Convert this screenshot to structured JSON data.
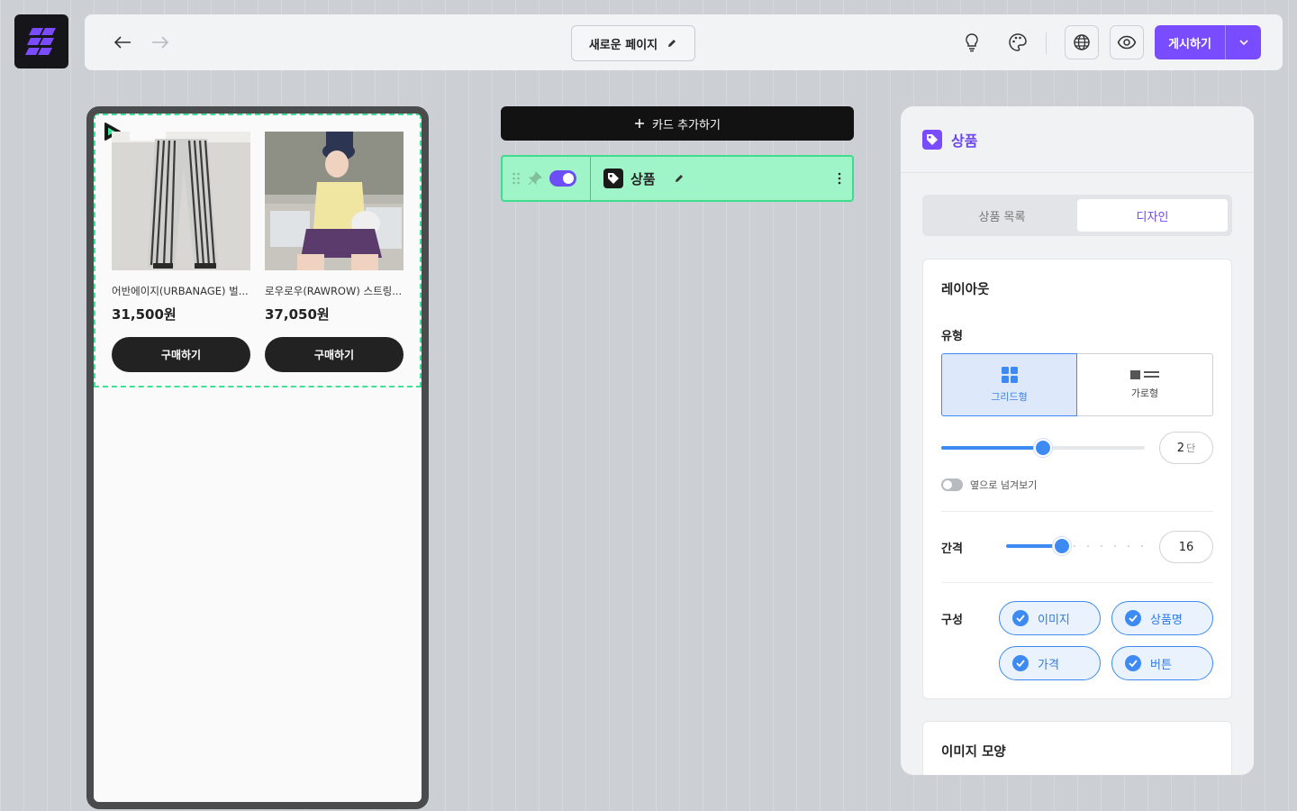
{
  "toolbar": {
    "page_name": "새로운 페이지",
    "publish_label": "게시하기"
  },
  "preview": {
    "products": [
      {
        "name": "어반에이지(URBANAGE) 벌...",
        "price": "31,500원",
        "buy_label": "구매하기"
      },
      {
        "name": "로우로우(RAWROW) 스트링...",
        "price": "37,050원",
        "buy_label": "구매하기"
      }
    ]
  },
  "editor": {
    "add_card_label": "카드 추가하기",
    "card_title": "상품",
    "card_enabled": true
  },
  "panel": {
    "title": "상품",
    "tabs": [
      {
        "label": "상품 목록",
        "active": false
      },
      {
        "label": "디자인",
        "active": true
      }
    ],
    "layout": {
      "title": "레이아웃",
      "type_label": "유형",
      "types": [
        {
          "label": "그리드형",
          "selected": true
        },
        {
          "label": "가로형",
          "selected": false
        }
      ],
      "columns_value": "2",
      "columns_unit": "단",
      "swipe_label": "옆으로 넘겨보기",
      "swipe_enabled": false,
      "gap_label": "간격",
      "gap_value": "16",
      "compose_label": "구성",
      "compose_items": [
        {
          "label": "이미지",
          "checked": true
        },
        {
          "label": "상품명",
          "checked": true
        },
        {
          "label": "가격",
          "checked": true
        },
        {
          "label": "버튼",
          "checked": true
        }
      ]
    },
    "image_shape_title": "이미지 모양"
  },
  "colors": {
    "accent": "#7a4cff",
    "selection": "#3fe098",
    "blue": "#3d8bf2"
  }
}
